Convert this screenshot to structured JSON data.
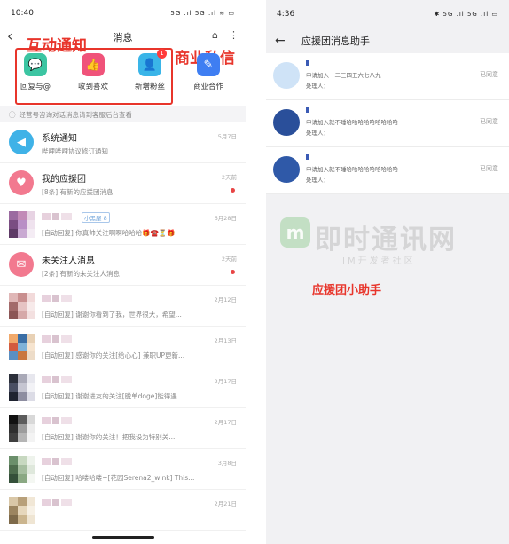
{
  "left": {
    "status": {
      "time": "10:40",
      "icons": "5G .ıl 5G .ıl ≋ ▭"
    },
    "header": {
      "title": "消息",
      "back": "‹",
      "shop_icon": "⌂",
      "more_icon": "⋮"
    },
    "annotations": {
      "interaction": "互动通知",
      "business": "商业私信"
    },
    "quick_actions": [
      {
        "label": "回复与@",
        "icon": "💬",
        "color": "#3cc5a2"
      },
      {
        "label": "收到喜欢",
        "icon": "👍",
        "color": "#f0537a"
      },
      {
        "label": "新增粉丝",
        "icon": "👤",
        "color": "#3ab5e8",
        "badge": "1"
      },
      {
        "label": "商业合作",
        "icon": "✎",
        "color": "#3f7ef2"
      }
    ],
    "notice": {
      "icon": "ⓘ",
      "text": "经营号咨询对话消息请到客服后台查看"
    },
    "rows": [
      {
        "name": "系统通知",
        "msg": "哔哩哔哩协议修订通知",
        "time": "5月7日",
        "avatar_color": "#3fb2e7",
        "avatar_icon": "◀",
        "dot": false
      },
      {
        "name": "我的应援团",
        "msg": "[8条] 有新的应援团消息",
        "time": "2天前",
        "avatar_color": "#f2798f",
        "avatar_icon": "♥",
        "dot": true
      },
      {
        "name": "",
        "tag": "小黑屋 8",
        "msg": "[自动回复] 你真帅关注啊啊哈哈哈🎁☎️⏳🎁",
        "time": "6月28日",
        "mosaic": [
          "#9b6aa0",
          "#c28ab7",
          "#e7d3e3",
          "#7a4d82",
          "#b98fc6",
          "#efe2ee",
          "#5e3a66",
          "#c9a9d2",
          "#f4ecf4"
        ],
        "dot": false
      },
      {
        "name": "未关注人消息",
        "msg": "[2条] 有新的未关注人消息",
        "time": "2天前",
        "avatar_color": "#f2798f",
        "avatar_icon": "✉",
        "dot": true
      },
      {
        "name": "",
        "msg": "[自动回复] 谢谢你看到了我，世界很大，希望...",
        "time": "2月12日",
        "mosaic": [
          "#e0b7b7",
          "#c98f8f",
          "#f2dada",
          "#a36a6a",
          "#e6c3c3",
          "#f7eaea",
          "#8c5656",
          "#d6a9a9",
          "#f3e0e0"
        ],
        "dot": false
      },
      {
        "name": "",
        "msg": "[自动回复] 感谢你的关注[给心心] 兼职UP更新...",
        "time": "2月13日",
        "mosaic": [
          "#f1a96b",
          "#3a6ea5",
          "#e8d1b5",
          "#d35b3f",
          "#7fb2d8",
          "#f6e4cf",
          "#5a8fc2",
          "#c9763e",
          "#eddcc8"
        ],
        "dot": false
      },
      {
        "name": "",
        "msg": "[自动回复] 谢谢进友的关注[脱单doge]能得遇...",
        "time": "2月17日",
        "mosaic": [
          "#2b2f3a",
          "#a9a9b7",
          "#e7e7ee",
          "#4a4f63",
          "#c5c5d1",
          "#f2f2f6",
          "#1f2330",
          "#8d8da0",
          "#dcdce6"
        ],
        "dot": false
      },
      {
        "name": "",
        "msg": "[自动回复] 谢谢你的关注！把我设为特别关...",
        "time": "2月17日",
        "mosaic": [
          "#111111",
          "#5c5c5c",
          "#d8d8d8",
          "#2e2e2e",
          "#9c9c9c",
          "#ececec",
          "#3f3f3f",
          "#b5b5b5",
          "#f3f3f3"
        ],
        "dot": false
      },
      {
        "name": "",
        "msg": "[自动回复] 哈喽哈喽~[花园Serena2_wink] This...",
        "time": "3月8日",
        "mosaic": [
          "#6b8f6b",
          "#c7d8c0",
          "#eef3ec",
          "#4e6d4e",
          "#a6bea0",
          "#dfe8dc",
          "#35503a",
          "#8aa883",
          "#f4f7f2"
        ],
        "dot": false
      },
      {
        "name": "",
        "msg": "",
        "time": "2月21日",
        "mosaic": [
          "#d9c7a7",
          "#b8a07a",
          "#f1e7d6",
          "#9c8560",
          "#e6d7bc",
          "#f7f1e6",
          "#7e6a4a",
          "#cbb58e",
          "#efe5d3"
        ],
        "dot": false
      }
    ]
  },
  "right": {
    "status": {
      "time": "4:36",
      "icons": "✱ 5G .ıl 5G .ıl ▭"
    },
    "header": {
      "title": "应援团消息助手",
      "back": "←"
    },
    "rows": [
      {
        "line1": "申请加入一二三四五六七八九",
        "line2": "处理人：",
        "status": "已同意",
        "avatar_color": "#cfe3f7"
      },
      {
        "line1": "申请加入就不睡哈哈哈哈哈哈哈哈哈",
        "line2": "处理人：",
        "status": "已同意",
        "avatar_color": "#2a4f9a"
      },
      {
        "line1": "申请加入就不睡哈哈哈哈哈哈哈哈哈",
        "line2": "处理人：",
        "status": "已同意",
        "avatar_color": "#2f59a8"
      }
    ],
    "watermark": {
      "logo": "m",
      "title": "即时通讯网",
      "subtitle": "IM开发者社区"
    },
    "annotation": "应援团小助手"
  }
}
